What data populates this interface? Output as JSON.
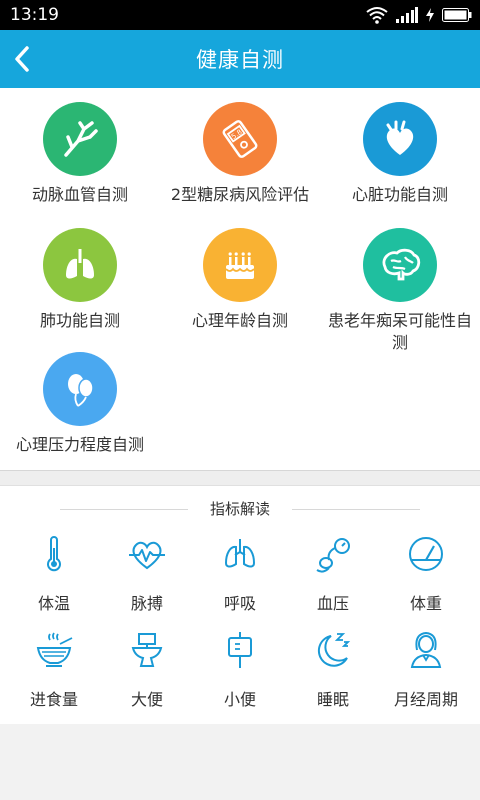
{
  "statusbar": {
    "time": "13:19"
  },
  "appbar": {
    "title": "健康自测"
  },
  "tests": [
    {
      "label": "动脉血管自测",
      "color": "#2bb673",
      "icon": "vessel-icon"
    },
    {
      "label": "2型糖尿病风险评估",
      "color": "#f5823a",
      "icon": "glucometer-icon"
    },
    {
      "label": "心脏功能自测",
      "color": "#1a9ad6",
      "icon": "heart-icon"
    },
    {
      "label": "肺功能自测",
      "color": "#8cc63f",
      "icon": "lungs-icon"
    },
    {
      "label": "心理年龄自测",
      "color": "#f9b233",
      "icon": "cake-icon"
    },
    {
      "label": "患老年痴呆可能性自测",
      "color": "#1fbf9f",
      "icon": "brain-icon"
    },
    {
      "label": "心理压力程度自测",
      "color": "#4aa8f0",
      "icon": "balloon-icon"
    }
  ],
  "indicators": {
    "title": "指标解读",
    "items": [
      {
        "label": "体温",
        "icon": "thermometer-icon"
      },
      {
        "label": "脉搏",
        "icon": "heartbeat-icon"
      },
      {
        "label": "呼吸",
        "icon": "lungs-icon"
      },
      {
        "label": "血压",
        "icon": "blood-pressure-icon"
      },
      {
        "label": "体重",
        "icon": "scale-icon"
      },
      {
        "label": "进食量",
        "icon": "food-bowl-icon"
      },
      {
        "label": "大便",
        "icon": "toilet-icon"
      },
      {
        "label": "小便",
        "icon": "urine-bag-icon"
      },
      {
        "label": "睡眠",
        "icon": "sleep-moon-icon"
      },
      {
        "label": "月经周期",
        "icon": "woman-icon"
      }
    ],
    "icon_color": "#1a9ad6"
  }
}
